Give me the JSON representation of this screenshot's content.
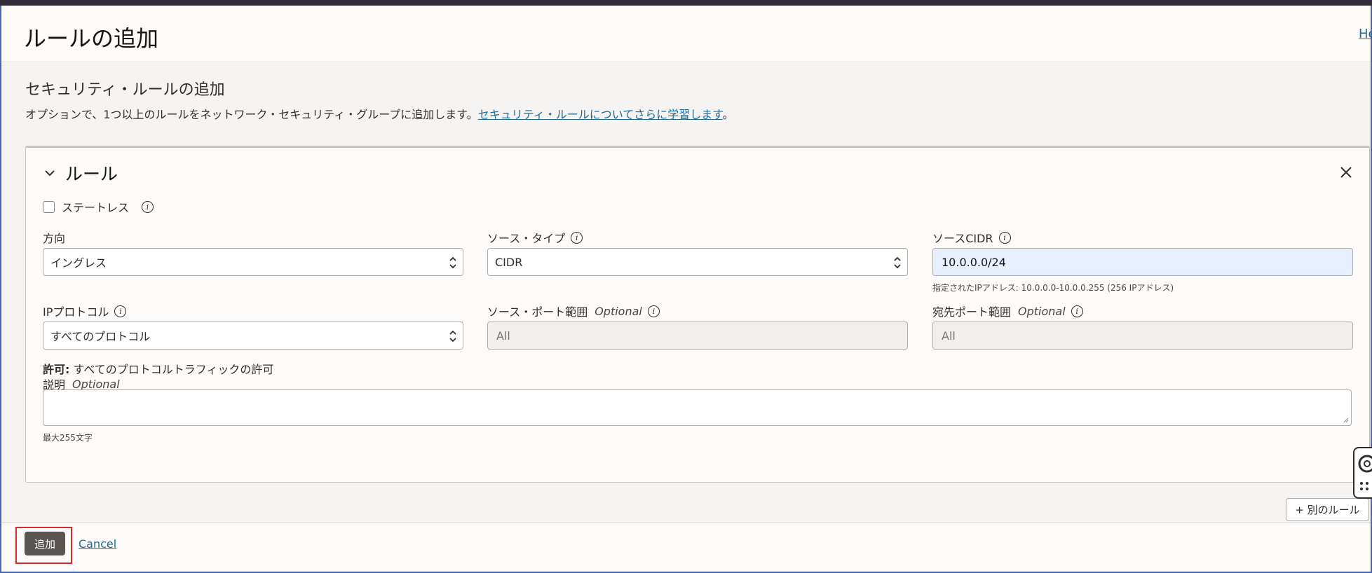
{
  "header": {
    "title": "ルールの追加",
    "help_link": "He"
  },
  "section": {
    "title": "セキュリティ・ルールの追加",
    "intro_text": "オプションで、1つ以上のルールをネットワーク・セキュリティ・グループに追加します。",
    "intro_link": "セキュリティ・ルールについてさらに学習します",
    "intro_suffix": "。"
  },
  "rule": {
    "title": "ルール",
    "stateless_label": "ステートレス",
    "direction": {
      "label": "方向",
      "value": "イングレス"
    },
    "source_type": {
      "label": "ソース・タイプ",
      "value": "CIDR"
    },
    "source_cidr": {
      "label": "ソースCIDR",
      "value": "10.0.0.0/24",
      "hint": "指定されたIPアドレス: 10.0.0.0-10.0.0.255 (256 IPアドレス)"
    },
    "ip_protocol": {
      "label": "IPプロトコル",
      "value": "すべてのプロトコル"
    },
    "source_port": {
      "label": "ソース・ポート範囲",
      "optional": "Optional",
      "value": "All"
    },
    "dest_port": {
      "label": "宛先ポート範囲",
      "optional": "Optional",
      "value": "All"
    },
    "allow": {
      "label": "許可:",
      "text": "すべてのプロトコルトラフィックの許可"
    },
    "description": {
      "label": "説明",
      "optional": "Optional",
      "value": "",
      "hint": "最大255文字"
    }
  },
  "add_another_rule": "+ 別のルール",
  "footer": {
    "primary": "追加",
    "cancel": "Cancel"
  },
  "colors": {
    "link": "#1f6b95",
    "primary_button": "#5b5552",
    "highlight_border": "#e0262a",
    "cidr_fill": "#e8f0fe"
  }
}
